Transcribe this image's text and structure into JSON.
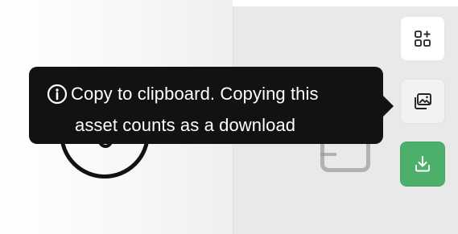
{
  "tooltip": {
    "line1": "Copy to clipboard. Copying this",
    "line2": "asset counts as a download",
    "icon": "info-icon"
  },
  "actions": [
    {
      "name": "add-to-collection",
      "icon": "grid-plus-icon"
    },
    {
      "name": "copy-to-clipboard",
      "icon": "copy-image-icon"
    },
    {
      "name": "download",
      "icon": "download-icon"
    }
  ],
  "colors": {
    "tooltip_bg": "#121212",
    "download_green": "#4caf6a",
    "panel_gray": "#e9e9e9"
  }
}
